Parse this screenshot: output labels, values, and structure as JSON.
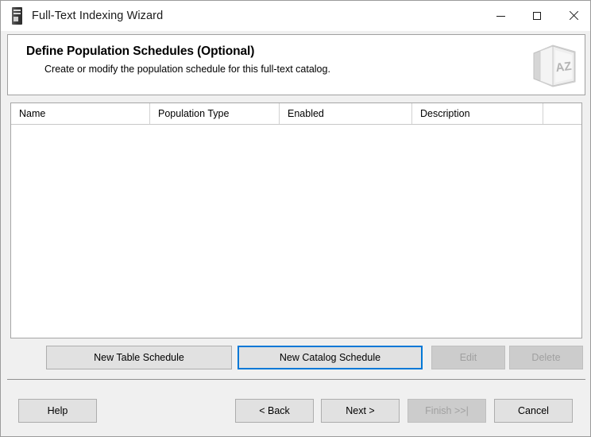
{
  "window": {
    "title": "Full-Text Indexing Wizard",
    "icon": "server-tower-icon",
    "controls": {
      "minimize": "minimize-icon",
      "maximize": "maximize-icon",
      "close": "close-icon"
    }
  },
  "header": {
    "title": "Define Population Schedules (Optional)",
    "subtitle": "Create or modify the population schedule for this full-text catalog.",
    "banner_icon": "az-book-icon",
    "banner_icon_text": "AZ"
  },
  "list": {
    "columns": [
      {
        "label": "Name"
      },
      {
        "label": "Population Type"
      },
      {
        "label": "Enabled"
      },
      {
        "label": "Description"
      },
      {
        "label": ""
      }
    ],
    "rows": []
  },
  "schedule_buttons": {
    "new_table": {
      "label": "New Table Schedule",
      "enabled": true,
      "focused": false
    },
    "new_catalog": {
      "label": "New Catalog Schedule",
      "enabled": true,
      "focused": true
    },
    "edit": {
      "label": "Edit",
      "enabled": false,
      "focused": false
    },
    "delete": {
      "label": "Delete",
      "enabled": false,
      "focused": false
    }
  },
  "nav_buttons": {
    "help": {
      "label": "Help",
      "enabled": true
    },
    "back": {
      "label": "< Back",
      "enabled": true
    },
    "next": {
      "label": "Next >",
      "enabled": true
    },
    "finish": {
      "label": "Finish >>|",
      "enabled": false
    },
    "cancel": {
      "label": "Cancel",
      "enabled": true
    }
  },
  "colors": {
    "accent": "#0078d7",
    "window_bg": "#f0f0f0",
    "panel_bg": "#ffffff",
    "button_bg": "#e1e1e1",
    "disabled_text": "#a0a0a0"
  }
}
